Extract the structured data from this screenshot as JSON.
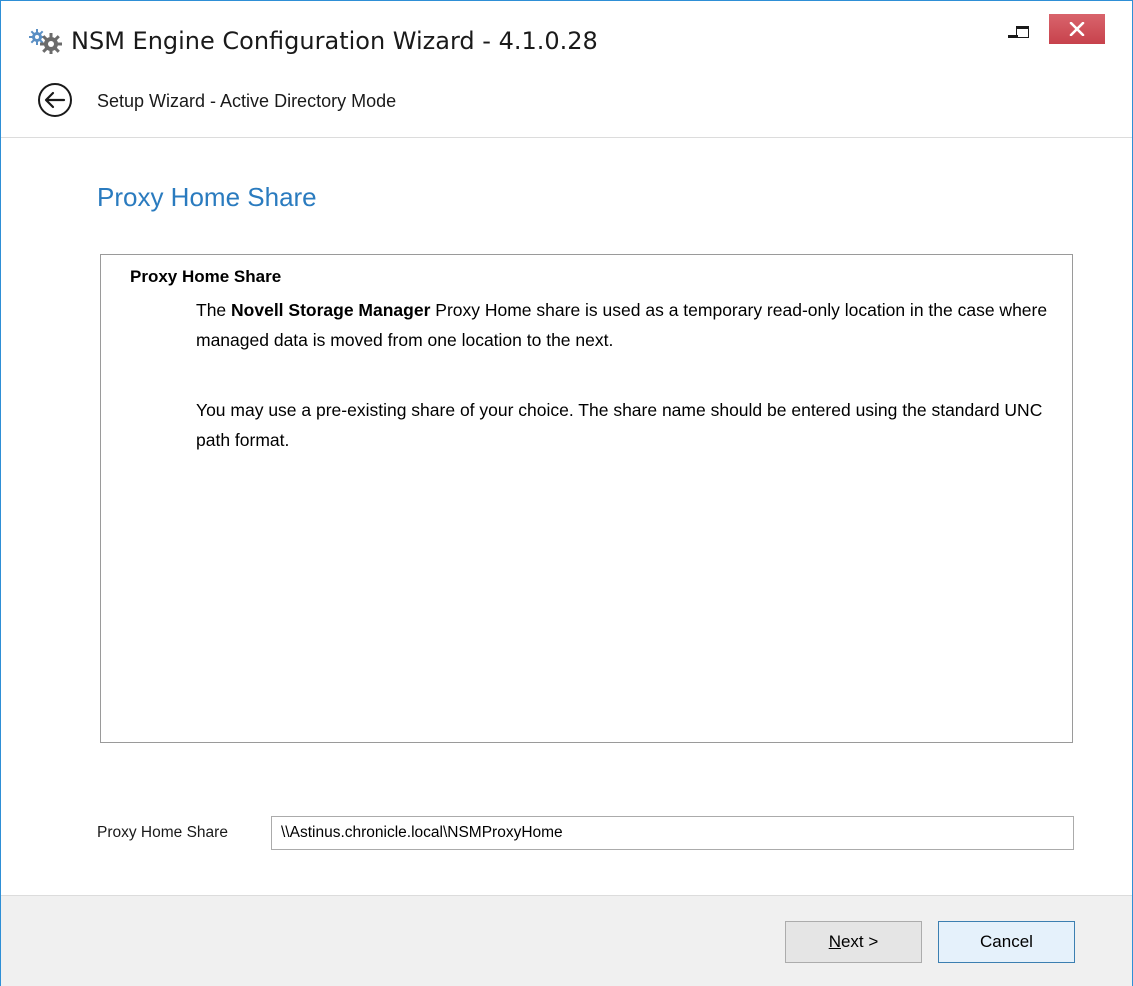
{
  "window": {
    "title": "NSM Engine Configuration Wizard - 4.1.0.28",
    "controls": {
      "minimize": "minimize-icon",
      "maximize": "maximize-icon",
      "close": "close-icon"
    },
    "close_color": "#c7424c",
    "border_color": "#2e8fd6"
  },
  "header": {
    "back_icon": "back-arrow-icon",
    "title": "Setup Wizard - Active Directory Mode"
  },
  "page": {
    "title": "Proxy Home Share",
    "title_color": "#2a7bbf"
  },
  "info": {
    "heading": "Proxy Home Share",
    "para1_prefix": "The ",
    "para1_bold": "Novell Storage Manager",
    "para1_rest": " Proxy Home share is used as a temporary read-only location in the case where managed data is moved from one location to the next.",
    "para2": "You may use a pre-existing share of your choice. The share name should be entered using the standard UNC path format."
  },
  "field": {
    "label": "Proxy Home Share",
    "value": "\\\\Astinus.chronicle.local\\NSMProxyHome"
  },
  "footer": {
    "next_label_underlined": "N",
    "next_label_rest": "ext >",
    "cancel_label": "Cancel"
  }
}
